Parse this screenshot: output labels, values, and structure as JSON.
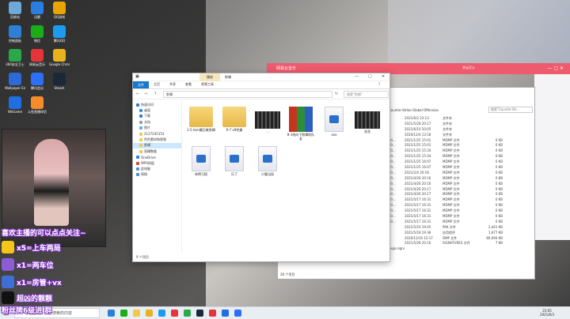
{
  "desktop_icons": [
    {
      "label": "回收站",
      "color": "#6ea9d8"
    },
    {
      "label": "迅雷",
      "color": "#2a7de1"
    },
    {
      "label": "QQ游戏",
      "color": "#e9a400"
    },
    {
      "label": "控制面板",
      "color": "#2f7fd6"
    },
    {
      "label": "微信",
      "color": "#1aad19"
    },
    {
      "label": "腾讯QQ",
      "color": "#1d9bf0"
    },
    {
      "label": "360安全卫士",
      "color": "#2aa84a"
    },
    {
      "label": "网易云音乐",
      "color": "#e5343a"
    },
    {
      "label": "Google Chrome",
      "color": "#e8b21f"
    },
    {
      "label": "Wallpaper Engine",
      "color": "#2c6bd6"
    },
    {
      "label": "腾讯会议",
      "color": "#2d6ff7"
    },
    {
      "label": "Steam",
      "color": "#1b2838"
    },
    {
      "label": "WeGame",
      "color": "#1f6fe0"
    },
    {
      "label": "斗鱼直播伴侣",
      "color": "#f48c2a"
    }
  ],
  "overlay": {
    "line1": "喜欢主播的可以点点关注~",
    "line2": "x5=上车两局",
    "line3": "x1=两车位",
    "line4": "x1=房管+vx",
    "line5": "超凶的靓靓",
    "bottom": "粉丝牌6级进 群"
  },
  "bg_window": {
    "title": "网易云音乐",
    "user": "李云灯火",
    "path": "Counter-Strike Global Offensive",
    "search": "搜索\"Counter-Str...",
    "item_count": "28 个项目",
    "rows": [
      {
        "name": "",
        "date": "2021/6/2 23:13",
        "type": "文件夹",
        "size": ""
      },
      {
        "name": "",
        "date": "2021/5/28 20:17",
        "type": "文件夹",
        "size": ""
      },
      {
        "name": "",
        "date": "2021/6/10 20:05",
        "type": "文件夹",
        "size": ""
      },
      {
        "name": "",
        "date": "2020/12/4 13:18",
        "type": "文件夹",
        "size": ""
      },
      {
        "name": "x0...",
        "date": "2021/1/25 15:01",
        "type": "MDMP 文件",
        "size": "0 KB"
      },
      {
        "name": "x0...",
        "date": "2021/1/25 15:01",
        "type": "MDMP 文件",
        "size": "0 KB"
      },
      {
        "name": "x0...",
        "date": "2021/1/25 15:34",
        "type": "MDMP 文件",
        "size": "0 KB"
      },
      {
        "name": "x0...",
        "date": "2021/1/25 15:34",
        "type": "MDMP 文件",
        "size": "0 KB"
      },
      {
        "name": "x0...",
        "date": "2021/1/25 16:07",
        "type": "MDMP 文件",
        "size": "0 KB"
      },
      {
        "name": "x0...",
        "date": "2021/1/25 16:07",
        "type": "MDMP 文件",
        "size": "0 KB"
      },
      {
        "name": "x0...",
        "date": "2021/2/4 20:18",
        "type": "MDMP 文件",
        "size": "0 KB"
      },
      {
        "name": "x0...",
        "date": "2021/4/26 20:16",
        "type": "MDMP 文件",
        "size": "0 KB"
      },
      {
        "name": "x0...",
        "date": "2021/4/26 20:16",
        "type": "MDMP 文件",
        "size": "0 KB"
      },
      {
        "name": "x0...",
        "date": "2021/4/26 20:17",
        "type": "MDMP 文件",
        "size": "0 KB"
      },
      {
        "name": "x0...",
        "date": "2021/4/26 20:17",
        "type": "MDMP 文件",
        "size": "0 KB"
      },
      {
        "name": "x0...",
        "date": "2021/5/17 16:31",
        "type": "MDMP 文件",
        "size": "0 KB"
      },
      {
        "name": "x0...",
        "date": "2021/5/17 16:31",
        "type": "MDMP 文件",
        "size": "0 KB"
      },
      {
        "name": "x0...",
        "date": "2021/5/17 16:31",
        "type": "MDMP 文件",
        "size": "0 KB"
      },
      {
        "name": "x0...",
        "date": "2021/5/17 16:31",
        "type": "MDMP 文件",
        "size": "0 KB"
      },
      {
        "name": "x0...",
        "date": "2021/5/17 16:31",
        "type": "MDMP 文件",
        "size": "0 KB"
      },
      {
        "name": "",
        "date": "2021/5/24 19:45",
        "type": "PAK 文件",
        "size": "2,441 KB"
      },
      {
        "name": "",
        "date": "2021/5/18 19:38",
        "type": "应用程序",
        "size": "1,677 KB"
      },
      {
        "name": "",
        "date": "2020/12/10 12:17",
        "type": "DMP 文件",
        "size": "80,094 KB"
      },
      {
        "name": "",
        "date": "2021/5/28 20:16",
        "type": "SIGNATURES 文件",
        "size": "7 KB"
      },
      {
        "name": "csgo.signatures",
        "date": "",
        "type": "",
        "size": ""
      }
    ]
  },
  "explorer": {
    "manage_tab": "播放",
    "window_name": "剪辑",
    "ribbon_tabs": [
      "文件",
      "主页",
      "共享",
      "查看",
      "视频工具"
    ],
    "address": "剪辑",
    "search_placeholder": "搜索\"剪辑\"",
    "nav": [
      {
        "label": "快速访问",
        "color": "#2f7fd6",
        "kind": "head"
      },
      {
        "label": "桌面",
        "color": "#3a8ee6",
        "kind": "sub"
      },
      {
        "label": "下载",
        "color": "#2f7fd6",
        "kind": "sub"
      },
      {
        "label": "文档",
        "color": "#8aa0b8",
        "kind": "sub"
      },
      {
        "label": "图片",
        "color": "#5ab0e8",
        "kind": "sub"
      },
      {
        "label": "2127245153",
        "color": "#f1c84b",
        "kind": "sub"
      },
      {
        "label": "色色素材和视频",
        "color": "#f1c84b",
        "kind": "sub"
      },
      {
        "label": "剪辑",
        "color": "#f1c84b",
        "kind": "sub"
      },
      {
        "label": "直播数据",
        "color": "#f1c84b",
        "kind": "sub"
      },
      {
        "label": "OneDrive",
        "color": "#2f7fd6",
        "kind": "head"
      },
      {
        "label": "WPS网盘",
        "color": "#d94a3a",
        "kind": "head"
      },
      {
        "label": "此电脑",
        "color": "#4f8fd6",
        "kind": "head"
      },
      {
        "label": "网络",
        "color": "#4f8fd6",
        "kind": "head"
      }
    ],
    "files": [
      {
        "label": "1-5 tom最后唯剪辑",
        "kind": "folder"
      },
      {
        "label": "9-7 x9完美",
        "kind": "folder"
      },
      {
        "label": "...",
        "kind": "video"
      },
      {
        "label": "8-1给向下剪辑的队友",
        "kind": "winrar"
      },
      {
        "label": "xxx",
        "kind": "media"
      },
      {
        "label": "花花",
        "kind": "video"
      },
      {
        "label": "宋明习梧",
        "kind": "media"
      },
      {
        "label": "乐了",
        "kind": "media"
      },
      {
        "label": "小猫当局",
        "kind": "media"
      }
    ],
    "status": "9 个项目"
  },
  "taskbar": {
    "search_placeholder": "在这里输入你要搜索的内容",
    "time": "23:05",
    "date": "2021/6/3",
    "icons": [
      "#2f7fd6",
      "#1aad19",
      "#f1c84b",
      "#e8b21f",
      "#1d9bf0",
      "#e5343a",
      "#2aa84a",
      "#1b2838",
      "#e5343a",
      "#1f6fe0",
      "#2d6ff7"
    ]
  }
}
